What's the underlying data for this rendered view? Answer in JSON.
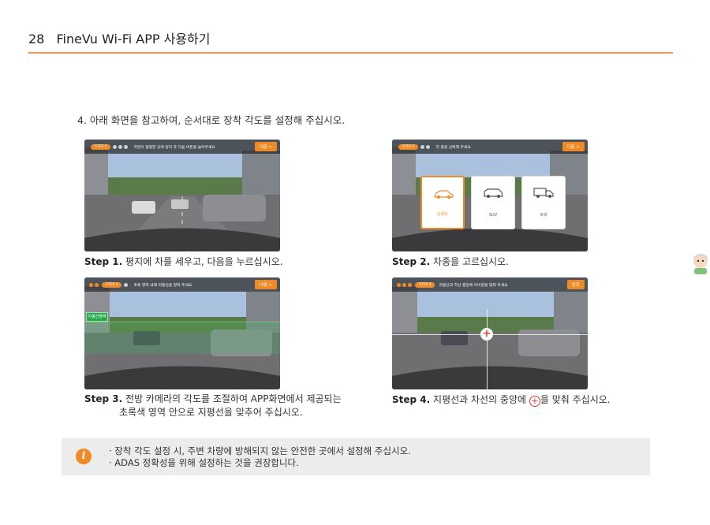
{
  "header": {
    "page_number": "28",
    "title": "FineVu Wi-Fi APP 사용하기"
  },
  "instruction": "4. 아래 화면을 참고하여, 순서대로 장착 각도를 설정해 주십시오.",
  "steps": [
    {
      "pill": "STEP 1",
      "bar_text": "지면이 평평한 곳에 정차 후 다음 버튼을 눌러주세요",
      "button": "다음 >",
      "step_label": "Step 1.",
      "caption": "평지에 차를 세우고, 다음을 누르십시오."
    },
    {
      "pill": "STEP 2",
      "bar_text": "차 종을 선택해 주세요",
      "button": "다음 >",
      "step_label": "Step 2.",
      "caption": "차종을 고르십시오.",
      "vehicles": [
        "승용차",
        "SUV",
        "트럭"
      ]
    },
    {
      "pill": "STEP 3",
      "bar_text": "초록 영역 내에 지평선을 맞춰 주세요",
      "button": "다음 >",
      "zone_label": "지평선영역",
      "step_label": "Step 3.",
      "caption": "전방 카메라의 각도를 조절하여 APP화면에서 제공되는",
      "caption2": "초록색 영역 안으로 지평선을 맞추어 주십시오."
    },
    {
      "pill": "STEP 4",
      "bar_text": "지평선과 차선 중앙에 아이콘을 맞춰 주세요",
      "button": "완료",
      "step_label": "Step 4.",
      "caption_before": "지평선과 차선의 중앙에",
      "caption_after": "을 맞춰 주십시오."
    }
  ],
  "note": {
    "icon": "info-icon",
    "lines": [
      "· 장착 각도 설정 시, 주변 차량에 방해되지 않는 안전한 곳에서 설정해 주십시오.",
      "· ADAS 정확성을 위해 설정하는 것을 권장합니다."
    ]
  },
  "colors": {
    "accent": "#f08a24",
    "rule": "#f29a55",
    "note_bg": "#ececec"
  }
}
